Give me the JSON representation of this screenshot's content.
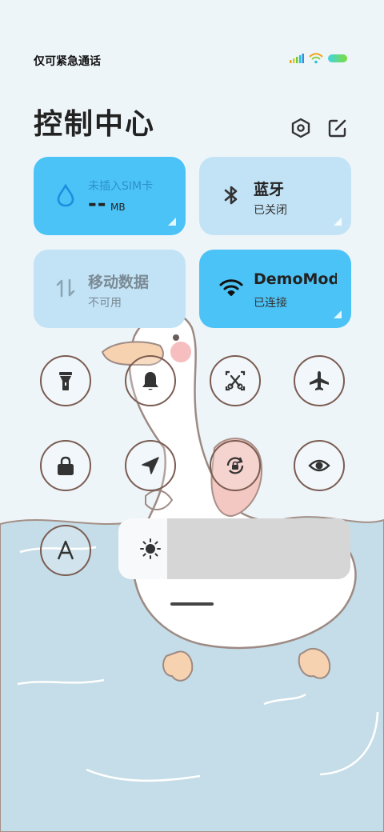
{
  "status": {
    "carrier_text": "仅可紧急通话"
  },
  "header": {
    "title": "控制中心",
    "settings_icon": "hexagon-settings-icon",
    "edit_icon": "edit-icon"
  },
  "tiles": {
    "data_usage": {
      "main": "--",
      "unit": "MB",
      "sub": "未插入SIM卡",
      "icon": "water-drop-icon",
      "color": "#4cc3f6"
    },
    "bluetooth": {
      "main": "蓝牙",
      "sub": "已关闭",
      "icon": "bluetooth-icon",
      "color": "#c2e3f6"
    },
    "mobile_data": {
      "main": "移动数据",
      "sub": "不可用",
      "icon": "mobile-data-icon",
      "color": "#c2e3f6"
    },
    "wifi": {
      "main": "DemoMod",
      "sub": "已连接",
      "icon": "wifi-icon",
      "color": "#4cc3f6"
    }
  },
  "toggles": [
    {
      "name": "flashlight",
      "icon": "flashlight-icon"
    },
    {
      "name": "silent",
      "icon": "bell-icon"
    },
    {
      "name": "screenshot",
      "icon": "screenshot-scissors-icon"
    },
    {
      "name": "airplane-mode",
      "icon": "airplane-icon"
    },
    {
      "name": "lock-screen",
      "icon": "lock-icon"
    },
    {
      "name": "location",
      "icon": "location-arrow-icon"
    },
    {
      "name": "rotation-lock",
      "icon": "rotation-lock-icon"
    },
    {
      "name": "reading-mode",
      "icon": "eye-icon"
    },
    {
      "name": "auto-brightness",
      "icon": "letter-a-icon"
    }
  ],
  "brightness": {
    "level": 0.21,
    "icon": "sun-icon"
  }
}
